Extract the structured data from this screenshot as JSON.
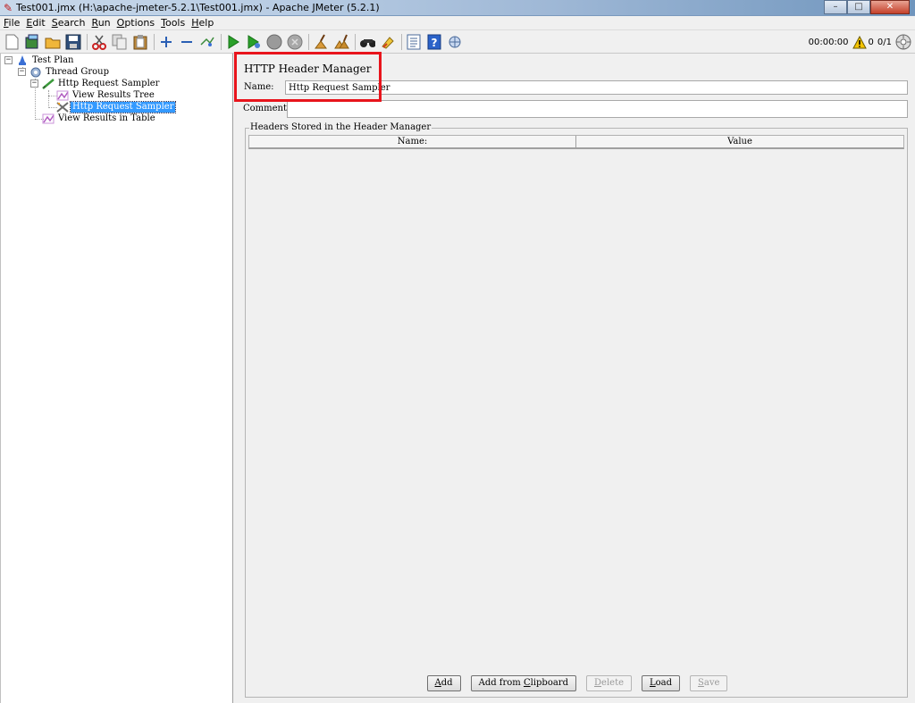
{
  "window": {
    "title": "Test001.jmx (H:\\apache-jmeter-5.2.1\\Test001.jmx) - Apache JMeter (5.2.1)",
    "minimize": "–",
    "maximize": "□",
    "close": "✕"
  },
  "menu": {
    "items": [
      {
        "key": "F",
        "rest": "ile"
      },
      {
        "key": "E",
        "rest": "dit"
      },
      {
        "key": "S",
        "rest": "earch"
      },
      {
        "key": "R",
        "rest": "un"
      },
      {
        "key": "O",
        "rest": "ptions"
      },
      {
        "key": "T",
        "rest": "ools"
      },
      {
        "key": "H",
        "rest": "elp"
      }
    ]
  },
  "toolbar": {
    "timer": "00:00:00",
    "warning_count": "0",
    "threads": "0/1",
    "icons": [
      "new-icon",
      "templates-icon",
      "open-icon",
      "save-icon",
      "cut-icon",
      "copy-icon",
      "paste-icon",
      "expand-icon",
      "collapse-icon",
      "toggle-icon",
      "start-icon",
      "start-no-pause-icon",
      "stop-icon",
      "shutdown-icon",
      "clear-icon",
      "clear-all-icon",
      "search-icon",
      "reset-search-icon",
      "function-helper-icon",
      "help-icon",
      "remote-icon"
    ]
  },
  "tree": {
    "nodes": [
      {
        "label": "Test Plan",
        "icon": "test-plan-icon"
      },
      {
        "label": "Thread Group",
        "icon": "thread-group-icon"
      },
      {
        "label": "Http Request Sampler",
        "icon": "sampler-icon"
      },
      {
        "label": "View Results Tree",
        "icon": "listener-icon"
      },
      {
        "label": "Http Request Sampler",
        "icon": "config-icon",
        "selected": true
      },
      {
        "label": "View Results in Table",
        "icon": "listener-icon"
      }
    ]
  },
  "panel": {
    "title": "HTTP Header Manager",
    "name_label": "Name:",
    "name_value": "Http Request Sampler",
    "comments_label": "Comments:",
    "comments_value": "",
    "group_title": "Headers Stored in the Header Manager",
    "columns": [
      "Name:",
      "Value"
    ],
    "rows": []
  },
  "buttons": {
    "add": {
      "pre": "",
      "key": "A",
      "post": "dd"
    },
    "add_clipboard": {
      "pre": "Add from ",
      "key": "C",
      "post": "lipboard"
    },
    "delete": {
      "pre": "",
      "key": "D",
      "post": "elete"
    },
    "load": {
      "pre": "",
      "key": "L",
      "post": "oad"
    },
    "save": {
      "pre": "",
      "key": "S",
      "post": "ave"
    }
  },
  "colors": {
    "highlight_box": "#e8141c",
    "selection": "#3399ff",
    "warning": "#f5c400"
  }
}
